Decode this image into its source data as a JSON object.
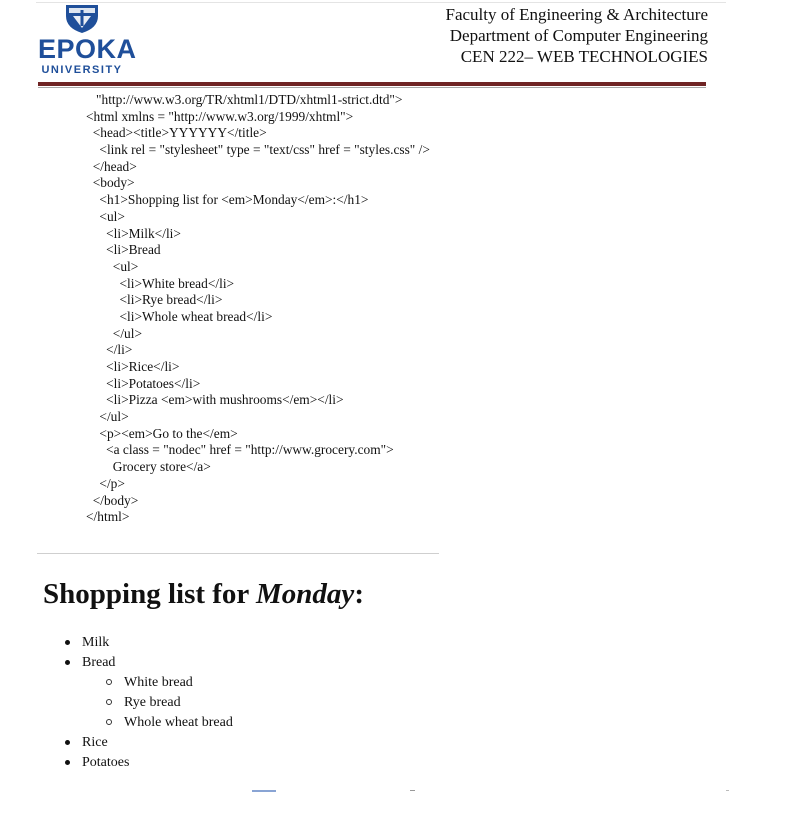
{
  "header": {
    "logo_name": "EPOKA",
    "logo_sub": "UNIVERSITY",
    "lines": [
      "Faculty of Engineering & Architecture",
      "Department of Computer Engineering",
      "CEN 222– WEB TECHNOLOGIES"
    ]
  },
  "code_lines": [
    "   \"http://www.w3.org/TR/xhtml1/DTD/xhtml1-strict.dtd\">",
    "<html xmlns = \"http://www.w3.org/1999/xhtml\">",
    "  <head><title>YYYYYY</title>",
    "    <link rel = \"stylesheet\" type = \"text/css\" href = \"styles.css\" />",
    "  </head>",
    "  <body>",
    "    <h1>Shopping list for <em>Monday</em>:</h1>",
    "    <ul>",
    "      <li>Milk</li>",
    "      <li>Bread",
    "        <ul>",
    "          <li>White bread</li>",
    "          <li>Rye bread</li>",
    "          <li>Whole wheat bread</li>",
    "        </ul>",
    "      </li>",
    "      <li>Rice</li>",
    "      <li>Potatoes</li>",
    "      <li>Pizza <em>with mushrooms</em></li>",
    "    </ul>",
    "    <p><em>Go to the</em>",
    "      <a class = \"nodec\" href = \"http://www.grocery.com\">",
    "        Grocery store</a>",
    "    </p>",
    "  </body>",
    "</html>"
  ],
  "rendered": {
    "heading_prefix": "Shopping list for ",
    "heading_em": "Monday",
    "heading_suffix": ":",
    "items": [
      "Milk",
      "Bread",
      "Rice",
      "Potatoes"
    ],
    "bread_subitems": [
      "White bread",
      "Rye bread",
      "Whole wheat bread"
    ]
  },
  "colors": {
    "logo_blue": "#1f4f9a",
    "rule_dark": "#6f2424"
  }
}
